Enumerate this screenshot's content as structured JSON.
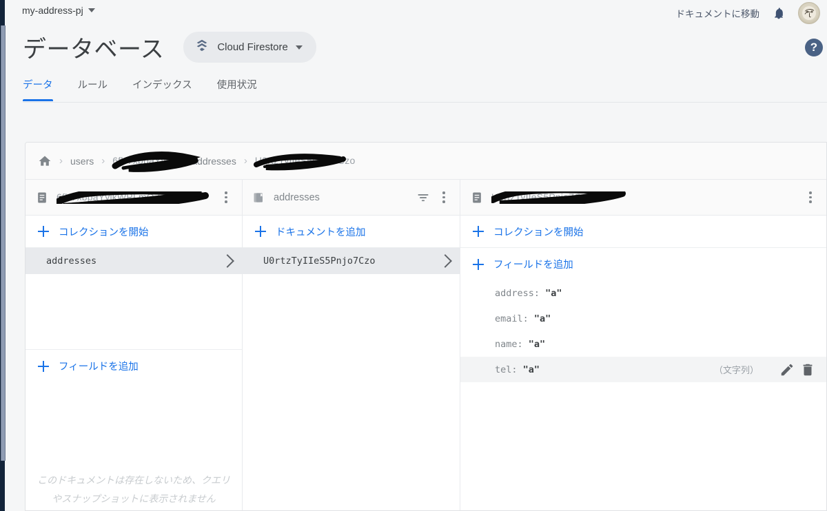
{
  "topbar": {
    "project_name": "my-address-pj",
    "project_caret_icon": "chevron-down-icon",
    "goto_docs_label": "ドキュメントに移動",
    "bell_icon": "notifications-bell-icon",
    "avatar_icon": "user-avatar",
    "help_label": "?"
  },
  "header": {
    "title": "データベース",
    "db_chip_label": "Cloud Firestore",
    "db_chip_icon": "firestore-logo-icon",
    "db_chip_caret_icon": "chevron-down-icon"
  },
  "tabs": [
    {
      "label": "データ",
      "active": true
    },
    {
      "label": "ルール",
      "active": false
    },
    {
      "label": "インデックス",
      "active": false
    },
    {
      "label": "使用状況",
      "active": false
    }
  ],
  "breadcrumb": {
    "home_icon": "home-icon",
    "separator": "›",
    "items": [
      {
        "label": "users",
        "redacted": false
      },
      {
        "label": "6fhYxbpaYyjk",
        "redacted": true
      },
      {
        "label": "addresses",
        "redacted": false
      },
      {
        "label": "U0rtzTyIIeS5Pnjo7Czo",
        "redacted": true
      }
    ]
  },
  "columns": {
    "col1": {
      "header": {
        "icon": "document-icon",
        "title": "6fhYxbpaYyjkWPLmQZsq",
        "redacted": true,
        "kebab_icon": "more-vert-icon"
      },
      "add_link": {
        "label": "コレクションを開始",
        "icon": "plus-icon"
      },
      "items": [
        {
          "label": "addresses",
          "selected": true,
          "chevron_icon": "chevron-right-icon"
        }
      ],
      "add_field_link": {
        "label": "フィールドを追加",
        "icon": "plus-icon"
      },
      "note": "このドキュメントは存在しないため、クエリやスナップショットに表示されません"
    },
    "col2": {
      "header": {
        "icon": "collection-icon",
        "title": "addresses",
        "redacted": false,
        "filter_icon": "filter-icon",
        "kebab_icon": "more-vert-icon"
      },
      "add_link": {
        "label": "ドキュメントを追加",
        "icon": "plus-icon"
      },
      "items": [
        {
          "label": "U0rtzTyIIeS5Pnjo7Czo",
          "selected": true,
          "chevron_icon": "chevron-right-icon"
        }
      ]
    },
    "col3": {
      "header": {
        "icon": "document-icon",
        "title": "U0rtzTyIIeS5Pnjo7Czo",
        "redacted": true,
        "kebab_icon": "more-vert-icon"
      },
      "add_link": {
        "label": "コレクションを開始",
        "icon": "plus-icon"
      },
      "add_field_link": {
        "label": "フィールドを追加",
        "icon": "plus-icon"
      },
      "fields": [
        {
          "key": "address",
          "value": "\"a\"",
          "hovered": false,
          "type": ""
        },
        {
          "key": "email",
          "value": "\"a\"",
          "hovered": false,
          "type": ""
        },
        {
          "key": "name",
          "value": "\"a\"",
          "hovered": false,
          "type": ""
        },
        {
          "key": "tel",
          "value": "\"a\"",
          "hovered": true,
          "type": "（文字列）",
          "edit_icon": "pencil-icon",
          "delete_icon": "trash-icon"
        }
      ]
    }
  },
  "colors": {
    "accent_blue": "#1a73e8",
    "rail_dark": "#13243a",
    "chip_bg": "#e8eaed",
    "selected_row": "#e8eaed",
    "help_circle": "#4a6285"
  }
}
